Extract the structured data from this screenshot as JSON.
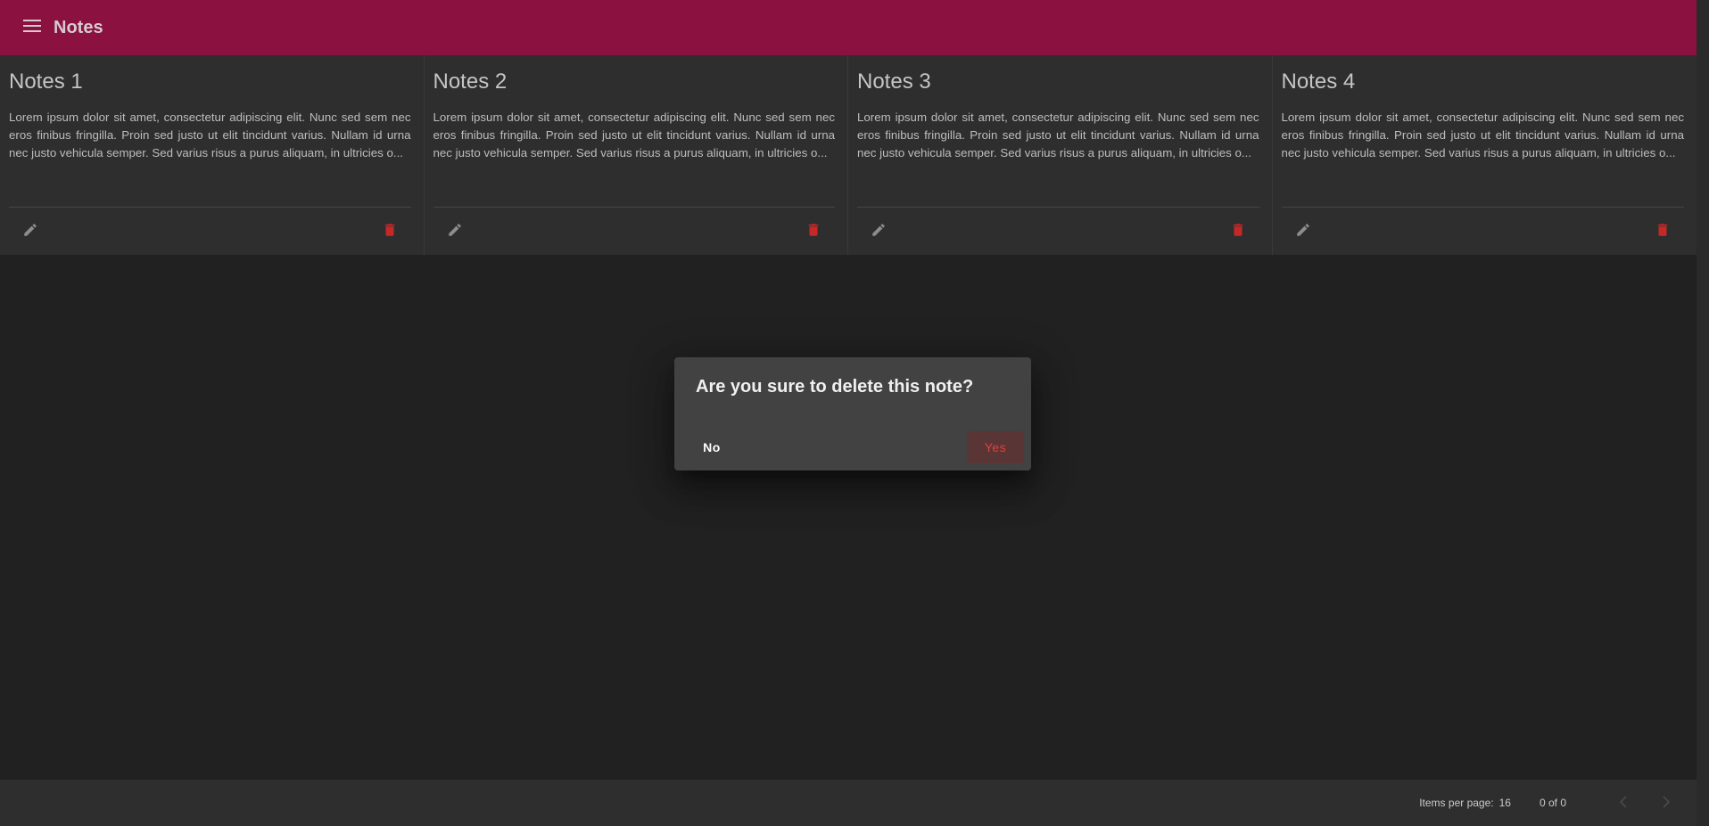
{
  "header": {
    "title": "Notes",
    "menu_icon": "menu-icon",
    "color": "#8a1140"
  },
  "notes": [
    {
      "title": "Notes 1",
      "body": "Lorem ipsum dolor sit amet, consectetur adipiscing elit. Nunc sed sem nec eros finibus fringilla. Proin sed justo ut elit tincidunt varius. Nullam id urna nec justo vehicula semper. Sed varius risus a purus aliquam, in ultricies o..."
    },
    {
      "title": "Notes 2",
      "body": "Lorem ipsum dolor sit amet, consectetur adipiscing elit. Nunc sed sem nec eros finibus fringilla. Proin sed justo ut elit tincidunt varius. Nullam id urna nec justo vehicula semper. Sed varius risus a purus aliquam, in ultricies o..."
    },
    {
      "title": "Notes 3",
      "body": "Lorem ipsum dolor sit amet, consectetur adipiscing elit. Nunc sed sem nec eros finibus fringilla. Proin sed justo ut elit tincidunt varius. Nullam id urna nec justo vehicula semper. Sed varius risus a purus aliquam, in ultricies o..."
    },
    {
      "title": "Notes 4",
      "body": "Lorem ipsum dolor sit amet, consectetur adipiscing elit. Nunc sed sem nec eros finibus fringilla. Proin sed justo ut elit tincidunt varius. Nullam id urna nec justo vehicula semper. Sed varius risus a purus aliquam, in ultricies o..."
    }
  ],
  "card_icons": {
    "edit": "pencil-icon",
    "delete": "trash-icon",
    "delete_color": "#c62828"
  },
  "dialog": {
    "title": "Are you sure to delete this note?",
    "no_label": "No",
    "yes_label": "Yes",
    "yes_color": "#e0413b"
  },
  "paginator": {
    "items_per_page_label": "Items per page:",
    "items_per_page_value": "16",
    "range_label": "0 of 0",
    "prev_icon": "chevron-left-icon",
    "next_icon": "chevron-right-icon"
  }
}
